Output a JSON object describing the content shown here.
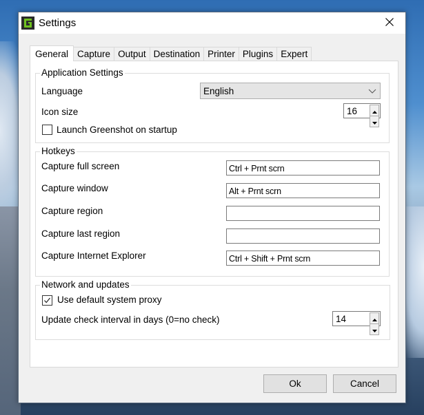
{
  "window": {
    "title": "Settings",
    "icon": "greenshot-app-icon",
    "close_icon": "close-icon"
  },
  "tabs": [
    {
      "label": "General",
      "active": true
    },
    {
      "label": "Capture",
      "active": false
    },
    {
      "label": "Output",
      "active": false
    },
    {
      "label": "Destination",
      "active": false
    },
    {
      "label": "Printer",
      "active": false
    },
    {
      "label": "Plugins",
      "active": false
    },
    {
      "label": "Expert",
      "active": false
    }
  ],
  "application_settings": {
    "title": "Application Settings",
    "language_label": "Language",
    "language_value": "English",
    "icon_size_label": "Icon size",
    "icon_size_value": "16",
    "launch_on_startup_label": "Launch Greenshot on startup",
    "launch_on_startup_checked": false
  },
  "hotkeys": {
    "title": "Hotkeys",
    "items": [
      {
        "label": "Capture full screen",
        "value": "Ctrl + Prnt scrn"
      },
      {
        "label": "Capture window",
        "value": "Alt + Prnt scrn"
      },
      {
        "label": "Capture region",
        "value": ""
      },
      {
        "label": "Capture last region",
        "value": ""
      },
      {
        "label": "Capture Internet Explorer",
        "value": "Ctrl + Shift + Prnt scrn"
      }
    ]
  },
  "network": {
    "title": "Network and updates",
    "proxy_label": "Use default system proxy",
    "proxy_checked": true,
    "interval_label": "Update check interval in days (0=no check)",
    "interval_value": "14"
  },
  "buttons": {
    "ok": "Ok",
    "cancel": "Cancel"
  },
  "colors": {
    "dialog_bg": "#f0f0f0",
    "panel_bg": "#ffffff",
    "app_icon_green": "#6fc21f"
  }
}
